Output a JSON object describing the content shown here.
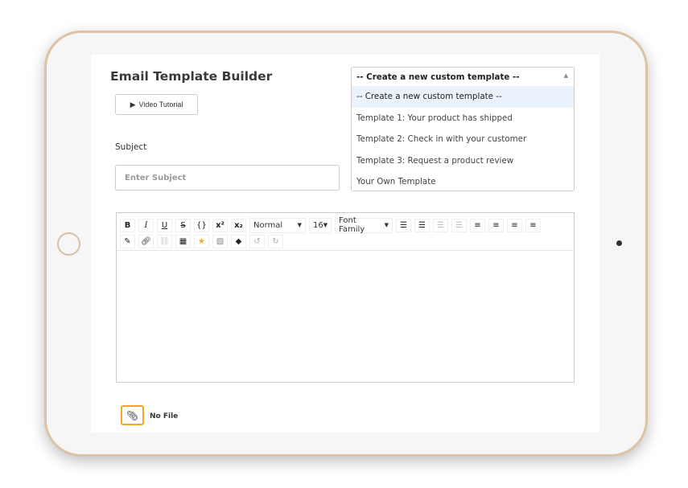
{
  "header": {
    "title": "Email Template Builder",
    "video_tutorial": "Video Tutorial"
  },
  "subject": {
    "label": "Subject",
    "placeholder": "Enter Subject",
    "value": ""
  },
  "template_select": {
    "selected": "-- Create a new custom template --",
    "options": [
      "-- Create a new custom template --",
      "Template 1: Your product has shipped",
      "Template 2: Check in with your customer",
      "Template 3: Request a product review",
      "Your Own Template"
    ]
  },
  "toolbar": {
    "bold": "B",
    "italic": "I",
    "underline": "U",
    "strike": "S",
    "code": "{}",
    "sup": "x²",
    "sub": "x₂",
    "format": "Normal",
    "size": "16",
    "font": "Font Family"
  },
  "attachment": {
    "status": "No File"
  },
  "colors": {
    "accent": "#f5a623",
    "frame": "#dcc3a6"
  }
}
